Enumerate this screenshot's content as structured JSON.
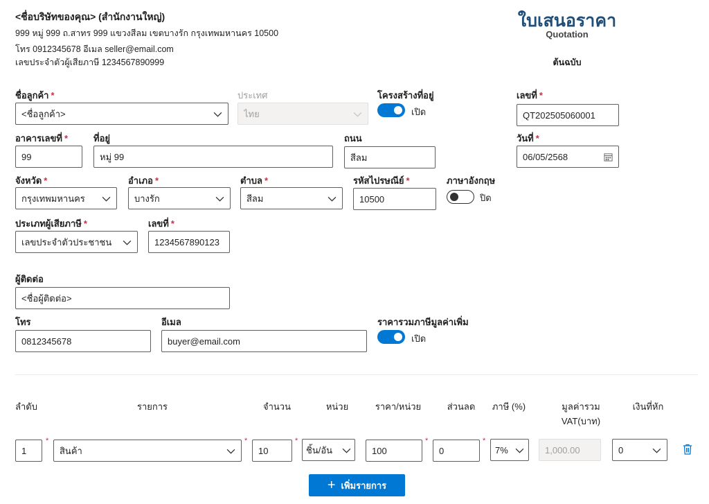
{
  "seller": {
    "name": "<ชื่อบริษัทของคุณ> (สำนักงานใหญ่)",
    "address": "999 หมู่ 999 ถ.สาทร 999 แขวงสีลม เขตบางรัก กรุงเทพมหานคร 10500",
    "contact": "โทร 0912345678 อีเมล seller@email.com",
    "tax_id": "เลขประจำตัวผู้เสียภาษี 1234567890999"
  },
  "document": {
    "title": "ใบเสนอราคา",
    "subtitle": "Quotation",
    "copy_label": "ต้นฉบับ"
  },
  "customer": {
    "name_label": "ชื่อลูกค้า",
    "name_value": "<ชื่อลูกค้า>",
    "country_label": "ประเทศ",
    "country_value": "ไทย",
    "structured_address_label": "โครงสร้างที่อยู่",
    "structured_address_state": "เปิด",
    "building_label": "อาคารเลขที่",
    "building_value": "99",
    "address_label": "ที่อยู่",
    "address_value": "หมู่ 99",
    "road_label": "ถนน",
    "road_value": "สีลม",
    "province_label": "จังหวัด",
    "province_value": "กรุงเทพมหานคร",
    "district_label": "อำเภอ",
    "district_value": "บางรัก",
    "subdistrict_label": "ตำบล",
    "subdistrict_value": "สีลม",
    "postcode_label": "รหัสไปรษณีย์",
    "postcode_value": "10500",
    "english_label": "ภาษาอังกฤษ",
    "english_state": "ปิด",
    "taxpayer_type_label": "ประเภทผู้เสียภาษี",
    "taxpayer_type_value": "เลขประจำตัวประชาชน",
    "tax_no_label": "เลขที่",
    "tax_no_value": "1234567890123"
  },
  "doc_info": {
    "number_label": "เลขที่",
    "number_value": "QT202505060001",
    "date_label": "วันที่",
    "date_value": "06/05/2568"
  },
  "contact": {
    "person_label": "ผู้ติดต่อ",
    "person_value": "<ชื่อผู้ติดต่อ>",
    "phone_label": "โทร",
    "phone_value": "0812345678",
    "email_label": "อีเมล",
    "email_value": "buyer@email.com",
    "vat_included_label": "ราคารวมภาษีมูลค่าเพิ่ม",
    "vat_included_state": "เปิด"
  },
  "items_table": {
    "headers": {
      "seq": "ลำดับ",
      "item": "รายการ",
      "qty": "จำนวน",
      "unit": "หน่วย",
      "unit_price": "ราคา/หน่วย",
      "discount": "ส่วนลด",
      "tax": "ภาษี (%)",
      "total_line1": "มูลค่ารวม",
      "total_line2": "VAT(บาท)",
      "withholding": "เงินที่หัก"
    },
    "rows": [
      {
        "seq": "1",
        "item": "สินค้า",
        "qty": "10",
        "unit": "ชิ้น/อัน",
        "unit_price": "100",
        "discount": "0",
        "tax": "7%",
        "total": "1,000.00",
        "withholding": "0"
      }
    ],
    "add_button_label": "เพิ่มรายการ"
  },
  "colors": {
    "primary": "#0078d4",
    "title": "#1f4e79",
    "required": "#c4314b"
  }
}
